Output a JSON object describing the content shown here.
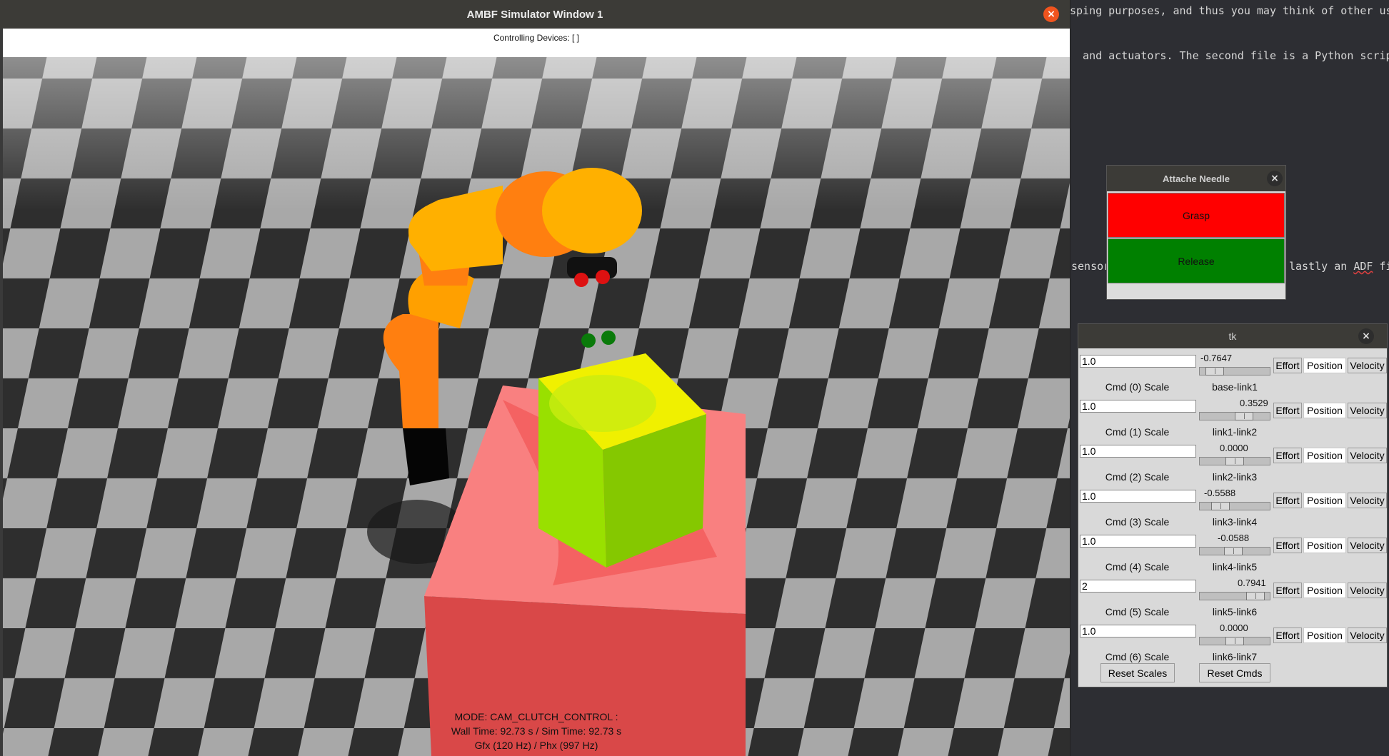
{
  "background_editor": {
    "lines": [
      {
        "text": "sping purposes, and thus you may think of other use ca"
      },
      {
        "text": "  and actuators. The second file is a Python script ar"
      },
      {
        "text": "sensor"
      },
      {
        "text": "lastly an "
      },
      {
        "text": "ADF"
      },
      {
        "text": " fil"
      }
    ]
  },
  "ambf_window": {
    "title": "AMBF Simulator Window 1",
    "close_glyph": "×",
    "top_overlay": "Controlling Devices: [ ]",
    "status": {
      "mode": "MODE: CAM_CLUTCH_CONTROL :",
      "time": "Wall Time: 92.73 s / Sim Time: 92.73 s",
      "rate": "Gfx (120 Hz) / Phx (997 Hz)"
    },
    "colors": {
      "checker_dark": "#2e2e2e",
      "checker_light": "#a8a8a8",
      "table_red": "#e85a5a",
      "cube_green": "#99e000",
      "cube_yellow": "#f0f000",
      "robot_orange": "#ff7f10",
      "robot_yellow": "#ffb000"
    }
  },
  "attache_window": {
    "title": "Attache Needle",
    "close_glyph": "×",
    "grasp_label": "Grasp",
    "release_label": "Release",
    "grasp_color": "#ff0000",
    "release_color": "#008000"
  },
  "tk_window": {
    "title": "tk",
    "close_glyph": "×",
    "rows": [
      {
        "scale": "1.0",
        "scale_label": "Cmd (0) Scale",
        "value": "-0.7647",
        "joint": "base-link1",
        "level": 0.1176
      },
      {
        "scale": "1.0",
        "scale_label": "Cmd (1) Scale",
        "value": "0.3529",
        "joint": "link1-link2",
        "level": 0.6765
      },
      {
        "scale": "1.0",
        "scale_label": "Cmd (2) Scale",
        "value": "0.0000",
        "joint": "link2-link3",
        "level": 0.5
      },
      {
        "scale": "1.0",
        "scale_label": "Cmd (3) Scale",
        "value": "-0.5588",
        "joint": "link3-link4",
        "level": 0.2206
      },
      {
        "scale": "1.0",
        "scale_label": "Cmd (4) Scale",
        "value": "-0.0588",
        "joint": "link4-link5",
        "level": 0.4706
      },
      {
        "scale": "2",
        "scale_label": "Cmd (5) Scale",
        "value": "0.7941",
        "joint": "link5-link6",
        "level": 0.8971
      },
      {
        "scale": "1.0",
        "scale_label": "Cmd (6) Scale",
        "value": "0.0000",
        "joint": "link6-link7",
        "level": 0.5
      }
    ],
    "effort_label": "Effort",
    "position_label": "Position",
    "velocity_label": "Velocity",
    "reset_scales_label": "Reset Scales",
    "reset_cmds_label": "Reset Cmds"
  }
}
